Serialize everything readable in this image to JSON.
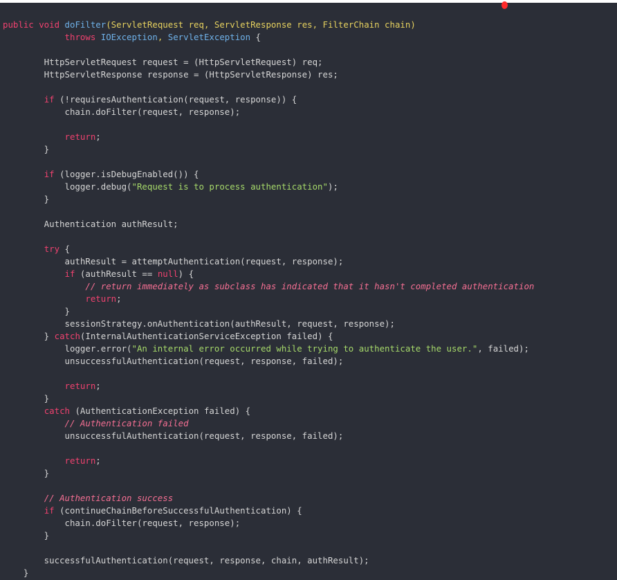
{
  "colors": {
    "background": "#2b2e37",
    "keyword": "#f0426f",
    "function": "#6fb1e8",
    "type": "#e6d15f",
    "string": "#a6d96a",
    "comment": "#f56f93",
    "plain": "#d6d6d6",
    "marker": "#ff2a2a"
  },
  "code": {
    "lines": [
      [
        [
          "kw",
          "public void "
        ],
        [
          "fn",
          "doFilter"
        ],
        [
          "ty",
          "(ServletRequest req, ServletResponse res, FilterChain chain)"
        ]
      ],
      [
        [
          "pl",
          "            "
        ],
        [
          "kw",
          "throws "
        ],
        [
          "fn",
          "IOException"
        ],
        [
          "ty",
          ", "
        ],
        [
          "fn",
          "ServletException"
        ],
        [
          "pl",
          " {"
        ]
      ],
      [],
      [
        [
          "pl",
          "        HttpServletRequest request = (HttpServletRequest) req;"
        ]
      ],
      [
        [
          "pl",
          "        HttpServletResponse response = (HttpServletResponse) res;"
        ]
      ],
      [],
      [
        [
          "pl",
          "        "
        ],
        [
          "kw",
          "if"
        ],
        [
          "pl",
          " (!requiresAuthentication(request, response)) {"
        ]
      ],
      [
        [
          "pl",
          "            chain.doFilter(request, response);"
        ]
      ],
      [],
      [
        [
          "pl",
          "            "
        ],
        [
          "kw",
          "return"
        ],
        [
          "pl",
          ";"
        ]
      ],
      [
        [
          "pl",
          "        }"
        ]
      ],
      [],
      [
        [
          "pl",
          "        "
        ],
        [
          "kw",
          "if"
        ],
        [
          "pl",
          " (logger.isDebugEnabled()) {"
        ]
      ],
      [
        [
          "pl",
          "            logger.debug("
        ],
        [
          "str",
          "\"Request is to process authentication\""
        ],
        [
          "pl",
          ");"
        ]
      ],
      [
        [
          "pl",
          "        }"
        ]
      ],
      [],
      [
        [
          "pl",
          "        Authentication authResult;"
        ]
      ],
      [],
      [
        [
          "pl",
          "        "
        ],
        [
          "kw",
          "try"
        ],
        [
          "pl",
          " {"
        ]
      ],
      [
        [
          "pl",
          "            authResult = attemptAuthentication(request, response);"
        ]
      ],
      [
        [
          "pl",
          "            "
        ],
        [
          "kw",
          "if"
        ],
        [
          "pl",
          " (authResult == "
        ],
        [
          "kw",
          "null"
        ],
        [
          "pl",
          ") {"
        ]
      ],
      [
        [
          "pl",
          "                "
        ],
        [
          "cm",
          "// return immediately as subclass has indicated that it hasn't completed authentication"
        ]
      ],
      [
        [
          "pl",
          "                "
        ],
        [
          "kw",
          "return"
        ],
        [
          "pl",
          ";"
        ]
      ],
      [
        [
          "pl",
          "            }"
        ]
      ],
      [
        [
          "pl",
          "            sessionStrategy.onAuthentication(authResult, request, response);"
        ]
      ],
      [
        [
          "pl",
          "        } "
        ],
        [
          "kw",
          "catch"
        ],
        [
          "pl",
          "(InternalAuthenticationServiceException failed) {"
        ]
      ],
      [
        [
          "pl",
          "            logger.error("
        ],
        [
          "str",
          "\"An internal error occurred while trying to authenticate the user.\""
        ],
        [
          "pl",
          ", failed);"
        ]
      ],
      [
        [
          "pl",
          "            unsuccessfulAuthentication(request, response, failed);"
        ]
      ],
      [],
      [
        [
          "pl",
          "            "
        ],
        [
          "kw",
          "return"
        ],
        [
          "pl",
          ";"
        ]
      ],
      [
        [
          "pl",
          "        }"
        ]
      ],
      [
        [
          "pl",
          "        "
        ],
        [
          "kw",
          "catch"
        ],
        [
          "pl",
          " (AuthenticationException failed) {"
        ]
      ],
      [
        [
          "pl",
          "            "
        ],
        [
          "cm",
          "// Authentication failed"
        ]
      ],
      [
        [
          "pl",
          "            unsuccessfulAuthentication(request, response, failed);"
        ]
      ],
      [],
      [
        [
          "pl",
          "            "
        ],
        [
          "kw",
          "return"
        ],
        [
          "pl",
          ";"
        ]
      ],
      [
        [
          "pl",
          "        }"
        ]
      ],
      [],
      [
        [
          "pl",
          "        "
        ],
        [
          "cm",
          "// Authentication success"
        ]
      ],
      [
        [
          "pl",
          "        "
        ],
        [
          "kw",
          "if"
        ],
        [
          "pl",
          " (continueChainBeforeSuccessfulAuthentication) {"
        ]
      ],
      [
        [
          "pl",
          "            chain.doFilter(request, response);"
        ]
      ],
      [
        [
          "pl",
          "        }"
        ]
      ],
      [],
      [
        [
          "pl",
          "        successfulAuthentication(request, response, chain, authResult);"
        ]
      ],
      [
        [
          "pl",
          "    }"
        ]
      ]
    ]
  }
}
